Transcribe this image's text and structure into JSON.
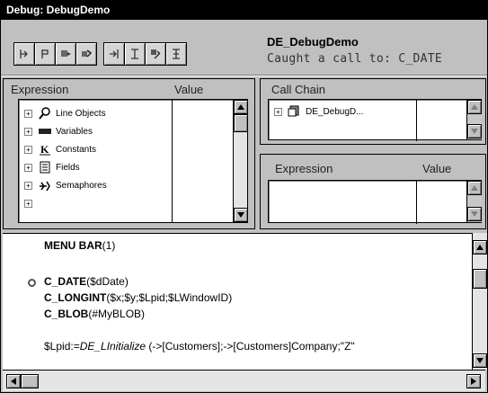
{
  "window": {
    "title": "Debug: DebugDemo"
  },
  "toolbar": {
    "buttons": [
      "step-icon",
      "trace-icon",
      "run-icon",
      "abort-icon",
      "step-into-icon",
      "step-over-icon",
      "edit-icon",
      "no-trace-icon"
    ]
  },
  "debug_info": {
    "method": "DE_DebugDemo",
    "caught": "Caught a call to: C_DATE"
  },
  "expression_panel": {
    "col_expression": "Expression",
    "col_value": "Value",
    "items": [
      {
        "label": "Line Objects",
        "icon": "magnifier-icon"
      },
      {
        "label": "Variables",
        "icon": "variables-icon"
      },
      {
        "label": "Constants",
        "icon": "constants-icon"
      },
      {
        "label": "Fields",
        "icon": "fields-icon"
      },
      {
        "label": "Semaphores",
        "icon": "semaphore-icon"
      }
    ]
  },
  "call_chain_panel": {
    "title": "Call Chain",
    "items": [
      {
        "label": "DE_DebugD...",
        "icon": "method-icon"
      }
    ]
  },
  "expression_panel2": {
    "col_expression": "Expression",
    "col_value": "Value"
  },
  "code": {
    "line1": "MENU BAR",
    "line1b": "(1)",
    "line2": "C_DATE",
    "line2b": "($dDate)",
    "line3": "C_LONGINT",
    "line3b": "($x;$y;$Lpid;$LWindowID)",
    "line4": "C_BLOB",
    "line4b": "(#MyBLOB)",
    "line5a": "$Lpid:=",
    "line5b": "DE_LInitialize",
    "line5c": " (->[Customers];->[Customers]Company;\"Z\""
  }
}
